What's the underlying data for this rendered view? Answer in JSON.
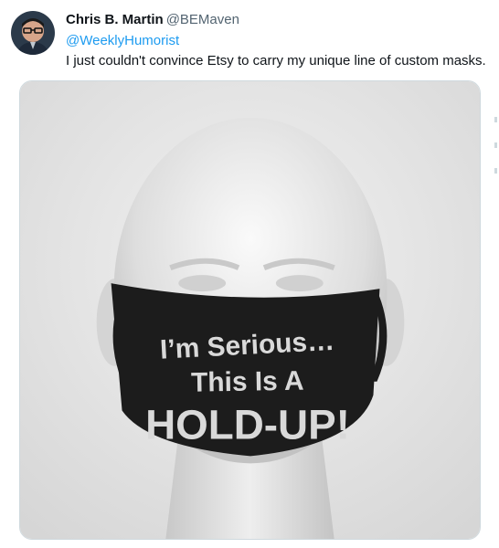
{
  "tweet": {
    "display_name": "Chris B. Martin",
    "handle": "@BEMaven",
    "reply_to": "@WeeklyHumorist",
    "text": "I just couldn't convince Etsy to carry my unique line of custom masks."
  },
  "media": {
    "mask_text": {
      "line1": "I’m Serious…",
      "line2": "This Is A",
      "line3": "HOLD-UP!"
    }
  },
  "colors": {
    "link": "#1d9bf0",
    "text": "#0f1419",
    "secondary": "#536471",
    "mask": "#1c1c1c",
    "mask_text": "#d9d9d9"
  }
}
